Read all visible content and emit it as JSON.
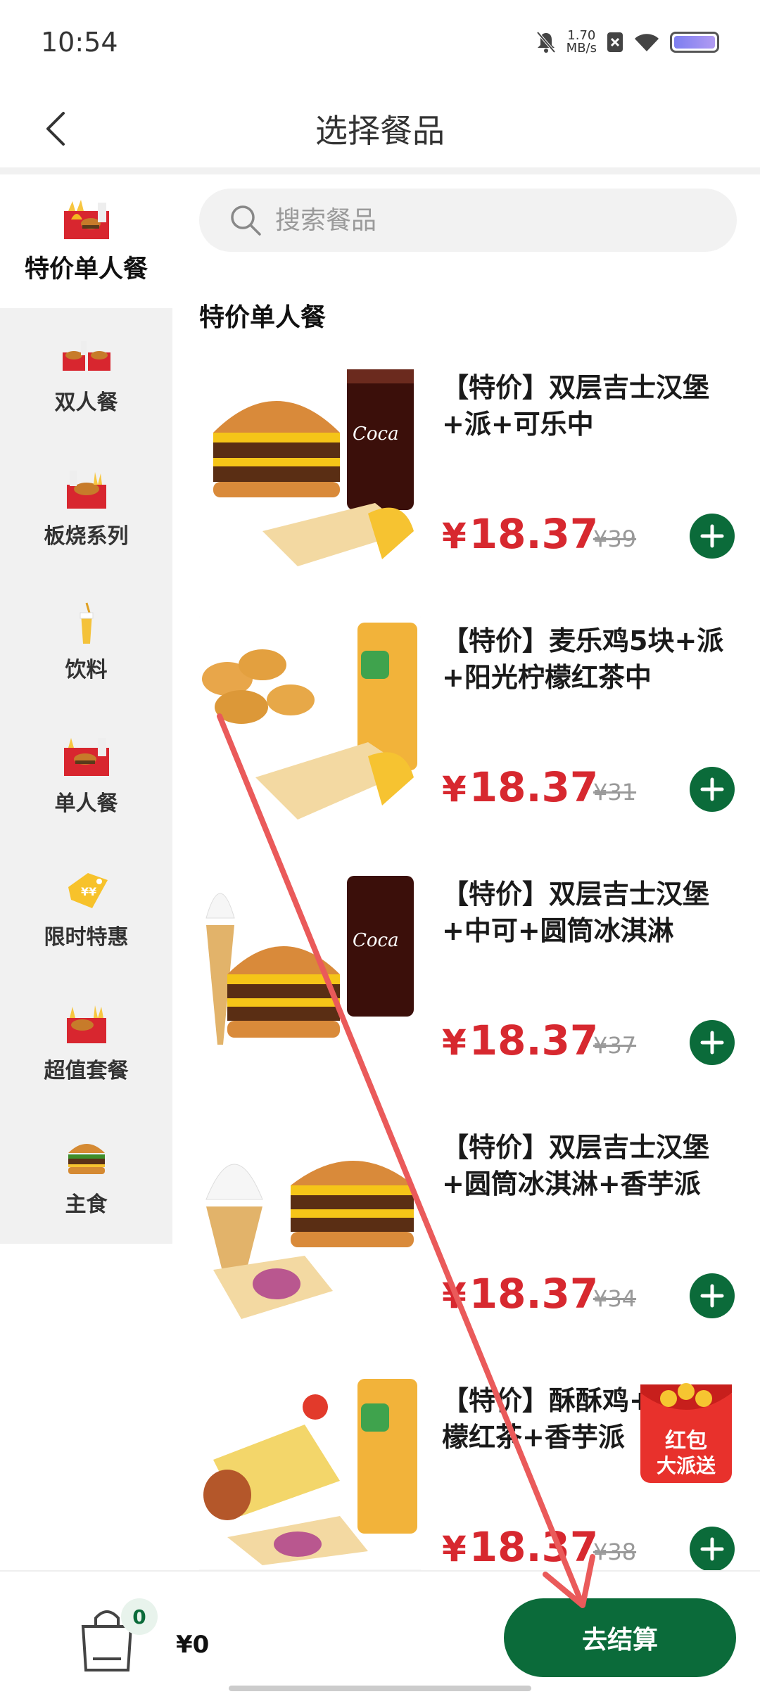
{
  "status_bar": {
    "time": "10:54",
    "net_speed_value": "1.70",
    "net_speed_unit": "MB/s"
  },
  "header": {
    "title": "选择餐品"
  },
  "sidebar": {
    "items": [
      {
        "label": "特价单人餐",
        "icon": "meal-combo-icon",
        "active": true
      },
      {
        "label": "双人餐",
        "icon": "double-meal-icon",
        "active": false
      },
      {
        "label": "板烧系列",
        "icon": "burger-fries-icon",
        "active": false
      },
      {
        "label": "饮料",
        "icon": "drink-icon",
        "active": false
      },
      {
        "label": "单人餐",
        "icon": "single-meal-icon",
        "active": false
      },
      {
        "label": "限时特惠",
        "icon": "price-tag-icon",
        "active": false
      },
      {
        "label": "超值套餐",
        "icon": "value-meal-icon",
        "active": false
      },
      {
        "label": "主食",
        "icon": "burger-icon",
        "active": false
      }
    ]
  },
  "search": {
    "placeholder": "搜索餐品"
  },
  "section": {
    "title": "特价单人餐"
  },
  "products": [
    {
      "name": "【特价】双层吉士汉堡+派+可乐中",
      "price": "18.37",
      "original_price": "¥39"
    },
    {
      "name": "【特价】麦乐鸡5块+派+阳光柠檬红茶中",
      "price": "18.37",
      "original_price": "¥31"
    },
    {
      "name": "【特价】双层吉士汉堡+中可+圆筒冰淇淋",
      "price": "18.37",
      "original_price": "¥37"
    },
    {
      "name": "【特价】双层吉士汉堡+圆筒冰淇淋+香芋派",
      "price": "18.37",
      "original_price": "¥34"
    },
    {
      "name": "【特价】酥酥鸡+阳光柠檬红茶+香芋派",
      "price": "18.37",
      "original_price": "¥38"
    }
  ],
  "promo": {
    "line1": "红包",
    "line2": "大派送"
  },
  "cart": {
    "count": "0",
    "total": "¥0",
    "checkout_label": "去结算"
  },
  "currency_symbol": "¥",
  "colors": {
    "accent": "#0b6b3a",
    "price": "#d7282f"
  }
}
